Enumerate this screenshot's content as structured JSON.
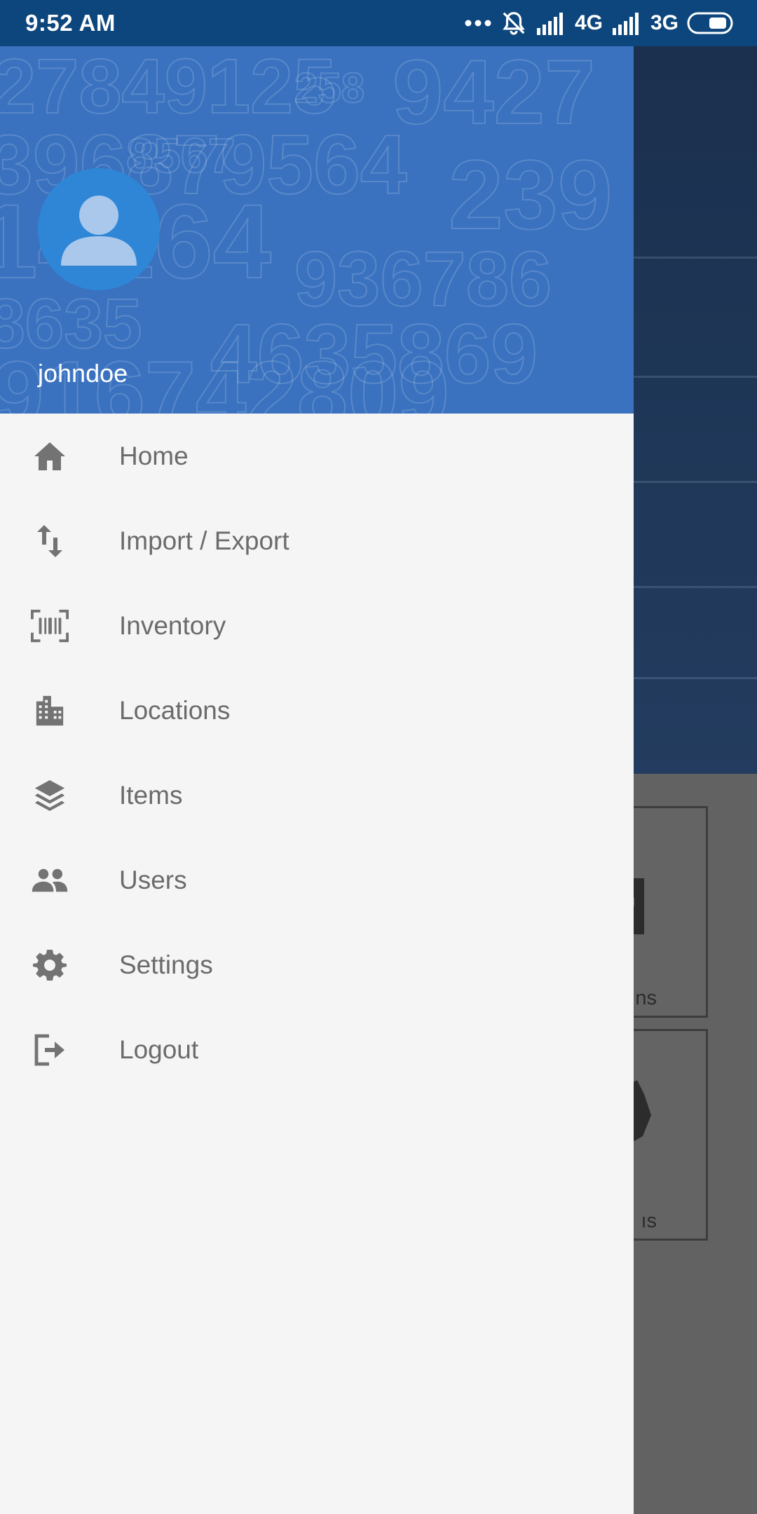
{
  "status_bar": {
    "time": "9:52 AM",
    "network_primary": "4G",
    "network_secondary": "3G",
    "icons": [
      "more-dots-icon",
      "alarm-off-icon",
      "signal-icon",
      "signal-icon",
      "battery-icon"
    ]
  },
  "drawer": {
    "header": {
      "username": "johndoe",
      "avatar_icon": "person-icon",
      "background_color": "#3a72bf"
    },
    "items": [
      {
        "label": "Home",
        "icon": "home-icon"
      },
      {
        "label": "Import / Export",
        "icon": "import-export-icon"
      },
      {
        "label": "Inventory",
        "icon": "barcode-scan-icon"
      },
      {
        "label": "Locations",
        "icon": "building-icon"
      },
      {
        "label": "Items",
        "icon": "layers-icon"
      },
      {
        "label": "Users",
        "icon": "people-icon"
      },
      {
        "label": "Settings",
        "icon": "gear-icon"
      },
      {
        "label": "Logout",
        "icon": "logout-icon"
      }
    ]
  },
  "background_app": {
    "cards": [
      {
        "partial_label": "ns"
      },
      {
        "partial_label": "ıs"
      }
    ]
  },
  "colors": {
    "status_bar": "#0d467d",
    "menu_text": "#6b6b6b",
    "menu_icon": "#737373",
    "drawer_bg": "#f5f5f5"
  }
}
